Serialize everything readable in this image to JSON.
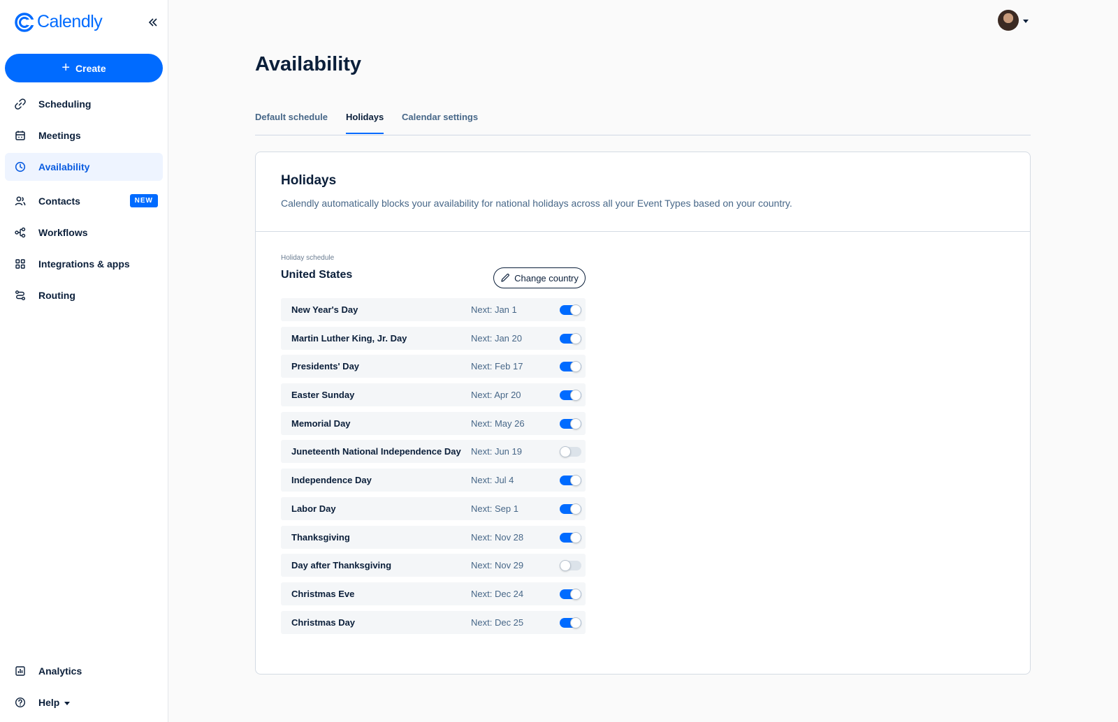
{
  "brand": {
    "name": "Calendly"
  },
  "sidebar": {
    "create_label": "Create",
    "items": [
      {
        "label": "Scheduling",
        "icon": "link-icon"
      },
      {
        "label": "Meetings",
        "icon": "calendar-icon"
      },
      {
        "label": "Availability",
        "icon": "clock-icon",
        "active": true
      },
      {
        "label": "Contacts",
        "icon": "contacts-icon",
        "badge": "NEW"
      },
      {
        "label": "Workflows",
        "icon": "workflow-icon"
      },
      {
        "label": "Integrations & apps",
        "icon": "grid-icon"
      },
      {
        "label": "Routing",
        "icon": "routing-icon"
      }
    ],
    "bottom": [
      {
        "label": "Analytics",
        "icon": "analytics-icon"
      },
      {
        "label": "Help",
        "icon": "help-icon"
      }
    ]
  },
  "page": {
    "title": "Availability",
    "tabs": [
      {
        "label": "Default schedule"
      },
      {
        "label": "Holidays",
        "active": true
      },
      {
        "label": "Calendar settings"
      }
    ]
  },
  "holidays": {
    "title": "Holidays",
    "description": "Calendly automatically blocks your availability for national holidays across all your Event Types based on your country.",
    "schedule_label": "Holiday schedule",
    "country": "United States",
    "change_country_label": "Change country",
    "items": [
      {
        "name": "New Year's Day",
        "next": "Next: Jan 1",
        "enabled": true
      },
      {
        "name": "Martin Luther King, Jr. Day",
        "next": "Next: Jan 20",
        "enabled": true
      },
      {
        "name": "Presidents' Day",
        "next": "Next: Feb 17",
        "enabled": true
      },
      {
        "name": "Easter Sunday",
        "next": "Next: Apr 20",
        "enabled": true
      },
      {
        "name": "Memorial Day",
        "next": "Next: May 26",
        "enabled": true
      },
      {
        "name": "Juneteenth National Independence Day",
        "next": "Next: Jun 19",
        "enabled": false
      },
      {
        "name": "Independence Day",
        "next": "Next: Jul 4",
        "enabled": true
      },
      {
        "name": "Labor Day",
        "next": "Next: Sep 1",
        "enabled": true
      },
      {
        "name": "Thanksgiving",
        "next": "Next: Nov 28",
        "enabled": true
      },
      {
        "name": "Day after Thanksgiving",
        "next": "Next: Nov 29",
        "enabled": false
      },
      {
        "name": "Christmas Eve",
        "next": "Next: Dec 24",
        "enabled": true
      },
      {
        "name": "Christmas Day",
        "next": "Next: Dec 25",
        "enabled": true
      }
    ]
  },
  "colors": {
    "accent": "#006bff",
    "text": "#0b1f3a",
    "muted": "#476788"
  }
}
